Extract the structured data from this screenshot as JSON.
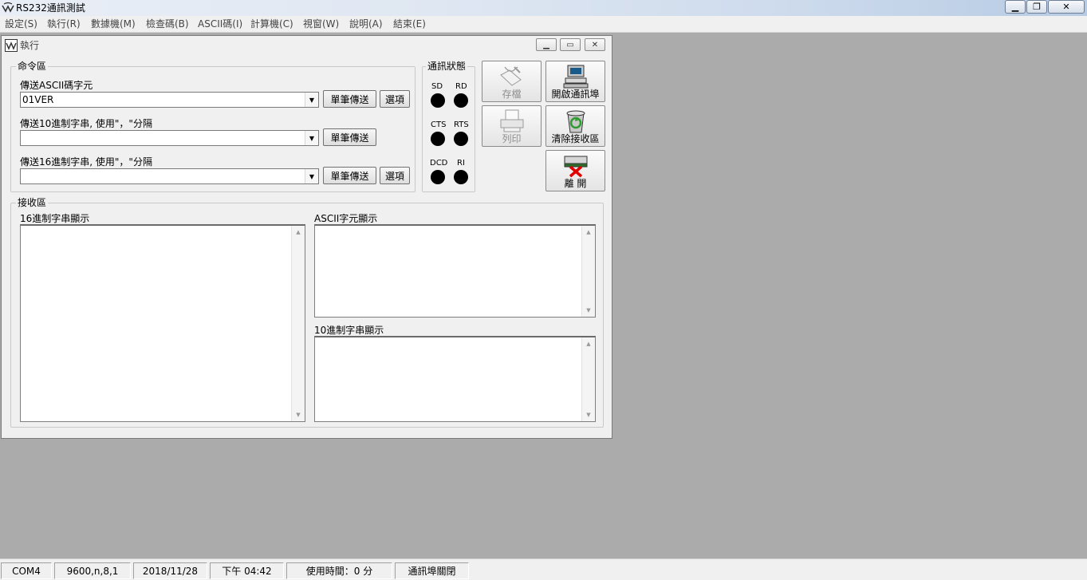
{
  "app": {
    "title": "RS232通訊測試",
    "icon": "app-logo-icon",
    "window_controls": {
      "minimize": "minimize-icon",
      "maximize": "restore-icon",
      "close": "close-icon"
    }
  },
  "menu": {
    "items": [
      "設定(S)",
      "執行(R)",
      "數據機(M)",
      "檢查碼(B)",
      "ASCII碼(I)",
      "計算機(C)",
      "視窗(W)",
      "說明(A)",
      "結束(E)"
    ]
  },
  "child_window": {
    "title": "執行",
    "icon": "child-logo-icon"
  },
  "command_area": {
    "title": "命令區",
    "ascii_label": "傳送ASCII碼字元",
    "ascii_value": "01VER",
    "dec_label": "傳送10進制字串, 使用\"，\"分隔",
    "dec_value": "",
    "hex_label": "傳送16進制字串, 使用\"，\"分隔",
    "hex_value": "",
    "send_single": "單筆傳送",
    "options": "選項"
  },
  "status_area": {
    "title": "通訊狀態",
    "signals": [
      "SD",
      "RD",
      "CTS",
      "RTS",
      "DCD",
      "RI"
    ]
  },
  "toolbar": {
    "save": "存檔",
    "print": "列印",
    "open_port": "開啟通訊埠",
    "clear_receive": "清除接收區",
    "leave": "離 開"
  },
  "receive_area": {
    "title": "接收區",
    "hex_label": "16進制字串顯示",
    "ascii_label": "ASCII字元顯示",
    "dec_label": "10進制字串顯示"
  },
  "status_bar": {
    "port": "COM4",
    "settings": "9600,n,8,1",
    "date": "2018/11/28",
    "time": "下午 04:42",
    "usage": "使用時間：0 分",
    "state": "通訊埠關閉"
  },
  "colors": {
    "background": "#ababab",
    "panel": "#f0f0f0",
    "led": "#000000",
    "leave_x": "#e00000"
  }
}
